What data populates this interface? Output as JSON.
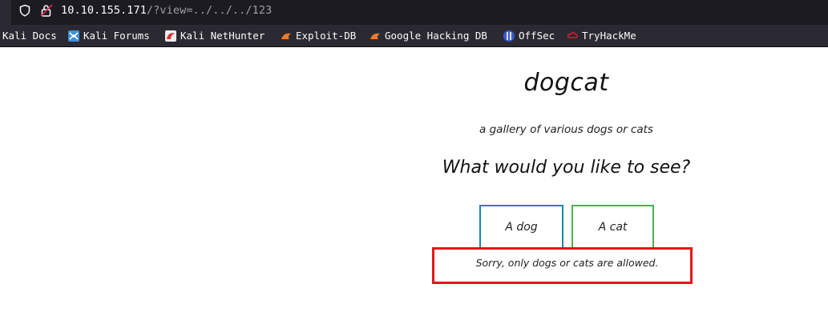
{
  "browser": {
    "url_host": "10.10.155.171",
    "url_path": "/?view=../../../123",
    "bookmarks": [
      {
        "label": "Kali Docs",
        "icon": "kali-docs-icon"
      },
      {
        "label": "Kali Forums",
        "icon": "kali-forums-icon"
      },
      {
        "label": "Kali NetHunter",
        "icon": "kali-nethunter-icon"
      },
      {
        "label": "Exploit-DB",
        "icon": "exploit-db-icon"
      },
      {
        "label": "Google Hacking DB",
        "icon": "ghdb-icon"
      },
      {
        "label": "OffSec",
        "icon": "offsec-icon"
      },
      {
        "label": "TryHackMe",
        "icon": "tryhackme-icon"
      }
    ]
  },
  "page": {
    "title": "dogcat",
    "subtitle": "a gallery of various dogs or cats",
    "question": "What would you like to see?",
    "buttons": {
      "dog": "A dog",
      "cat": "A cat"
    },
    "error_message": "Sorry, only dogs or cats are allowed."
  },
  "colors": {
    "dog_border": "#1a86b0",
    "cat_border": "#4caf50",
    "highlight": "#e8141a"
  }
}
